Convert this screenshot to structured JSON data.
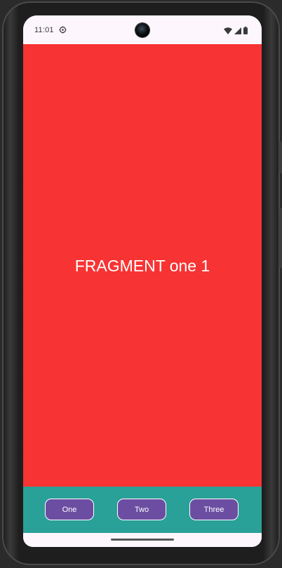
{
  "status_bar": {
    "time": "11:01",
    "icons": [
      "gear-icon",
      "wifi-icon",
      "signal-icon",
      "battery-icon"
    ]
  },
  "main": {
    "fragment_text": "FRAGMENT one 1",
    "background_color": "#f83333"
  },
  "bottom_nav": {
    "background_color": "#2aa198",
    "buttons": [
      {
        "label": "One"
      },
      {
        "label": "Two"
      },
      {
        "label": "Three"
      }
    ],
    "button_color": "#6b4ea2"
  }
}
